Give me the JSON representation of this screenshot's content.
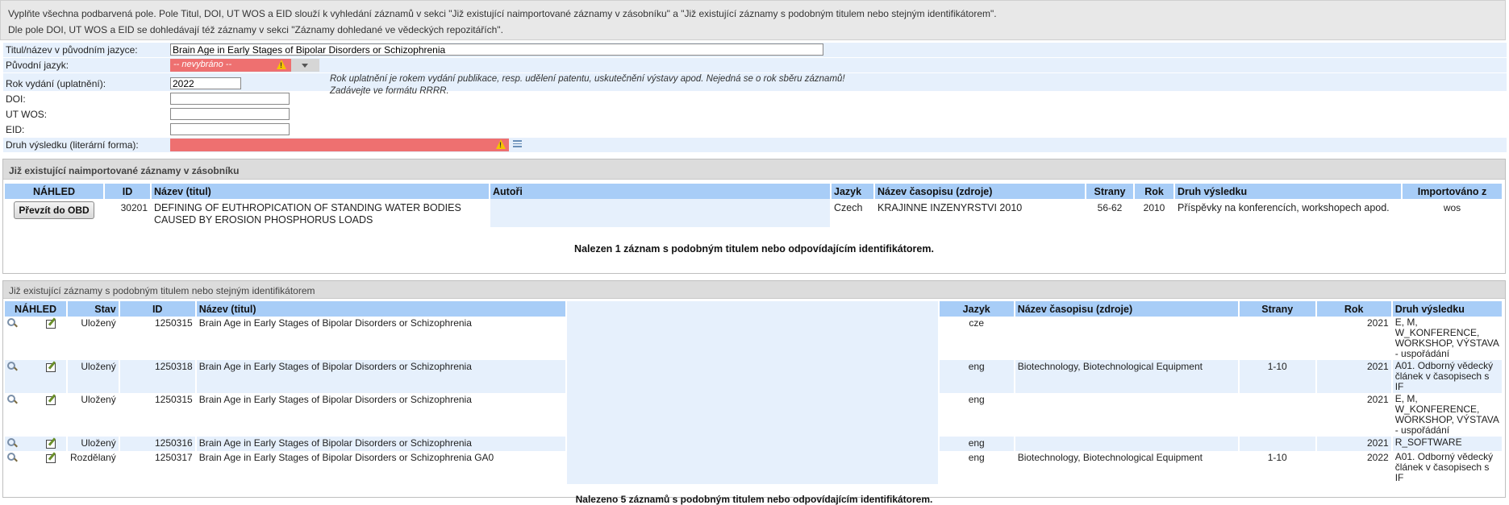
{
  "notes": [
    "Vyplňte všechna podbarvená pole. Pole Titul, DOI, UT WOS a EID slouží k vyhledání záznamů v sekci \"Již existující naimportované záznamy v zásobníku\" a \"Již existující záznamy s podobným titulem nebo stejným identifikátorem\".",
    "Dle pole DOI, UT WOS a EID se dohledávají též záznamy v sekci \"Záznamy dohledané ve vědeckých repozitářích\"."
  ],
  "form": {
    "title_label": "Titul/název v původním jazyce:",
    "title_value": "Brain Age in Early Stages of Bipolar Disorders or Schizophrenia",
    "lang_label": "Původní jazyk:",
    "lang_value": "-- nevybráno --",
    "year_label": "Rok vydání (uplatnění):",
    "year_value": "2022",
    "year_hint_1": "Rok uplatnění je rokem vydání publikace, resp. udělení patentu, uskutečnění výstavy apod. Nejedná se o rok sběru záznamů!",
    "year_hint_2": "Zadávejte ve formátu RRRR.",
    "doi_label": "DOI:",
    "doi_value": "",
    "utwos_label": "UT WOS:",
    "utwos_value": "",
    "eid_label": "EID:",
    "eid_value": "",
    "druh_label": "Druh výsledku (literární forma):",
    "druh_value": ""
  },
  "imported": {
    "title": "Již existující naimportované záznamy v zásobníku",
    "headers": [
      "NÁHLED",
      "ID",
      "Název (titul)",
      "Autoři",
      "Jazyk",
      "Název časopisu (zdroje)",
      "Strany",
      "Rok",
      "Druh výsledku",
      "Importováno z"
    ],
    "button": "Převzít do OBD",
    "row": {
      "id": "30201",
      "title": "DEFINING OF EUTHROPICATION OF STANDING WATER BODIES CAUSED BY EROSION PHOSPHORUS LOADS",
      "authors": "",
      "lang": "Czech",
      "journal": "KRAJINNE INZENYRSTVI 2010",
      "pages": "56-62",
      "year": "2010",
      "type": "Příspěvky na konferencích, workshopech apod.",
      "source": "wos"
    },
    "found": "Nalezen 1 záznam s podobným titulem nebo odpovídajícím identifikátorem."
  },
  "similar": {
    "title": "Již existující záznamy s podobným titulem nebo stejným identifikátorem",
    "headers": [
      "NÁHLED",
      "Stav",
      "ID",
      "Název (titul)",
      "",
      "Jazyk",
      "Název časopisu (zdroje)",
      "Strany",
      "Rok",
      "Druh výsledku"
    ],
    "rows": [
      {
        "state": "Uložený",
        "id": "1250315",
        "title": "Brain Age in Early Stages of Bipolar Disorders or Schizophrenia",
        "lang": "cze",
        "journal": "",
        "pages": "",
        "year": "2021",
        "type": "E, M, W_KONFERENCE, WORKSHOP, VÝSTAVA - uspořádání"
      },
      {
        "state": "Uložený",
        "id": "1250318",
        "title": "Brain Age in Early Stages of Bipolar Disorders or Schizophrenia",
        "lang": "eng",
        "journal": "Biotechnology, Biotechnological Equipment",
        "pages": "1-10",
        "year": "2021",
        "type": "A01. Odborný vědecký článek v časopisech s IF"
      },
      {
        "state": "Uložený",
        "id": "1250315",
        "title": "Brain Age in Early Stages of Bipolar Disorders or Schizophrenia",
        "lang": "eng",
        "journal": "",
        "pages": "",
        "year": "2021",
        "type": "E, M, W_KONFERENCE, WORKSHOP, VÝSTAVA - uspořádání"
      },
      {
        "state": "Uložený",
        "id": "1250316",
        "title": "Brain Age in Early Stages of Bipolar Disorders or Schizophrenia",
        "lang": "eng",
        "journal": "",
        "pages": "",
        "year": "2021",
        "type": "R_SOFTWARE"
      },
      {
        "state": "Rozdělaný",
        "id": "1250317",
        "title": "Brain Age in Early Stages of Bipolar Disorders or Schizophrenia GA0",
        "lang": "eng",
        "journal": "Biotechnology, Biotechnological Equipment",
        "pages": "1-10",
        "year": "2022",
        "type": "A01. Odborný vědecký článek v časopisech s IF"
      }
    ],
    "found": "Nalezeno 5 záznamů s podobným titulem nebo odpovídajícím identifikátorem."
  },
  "colors": {
    "header": "#a8cdf7",
    "row_alt": "#e6f0fc",
    "required": "#ee7070"
  }
}
